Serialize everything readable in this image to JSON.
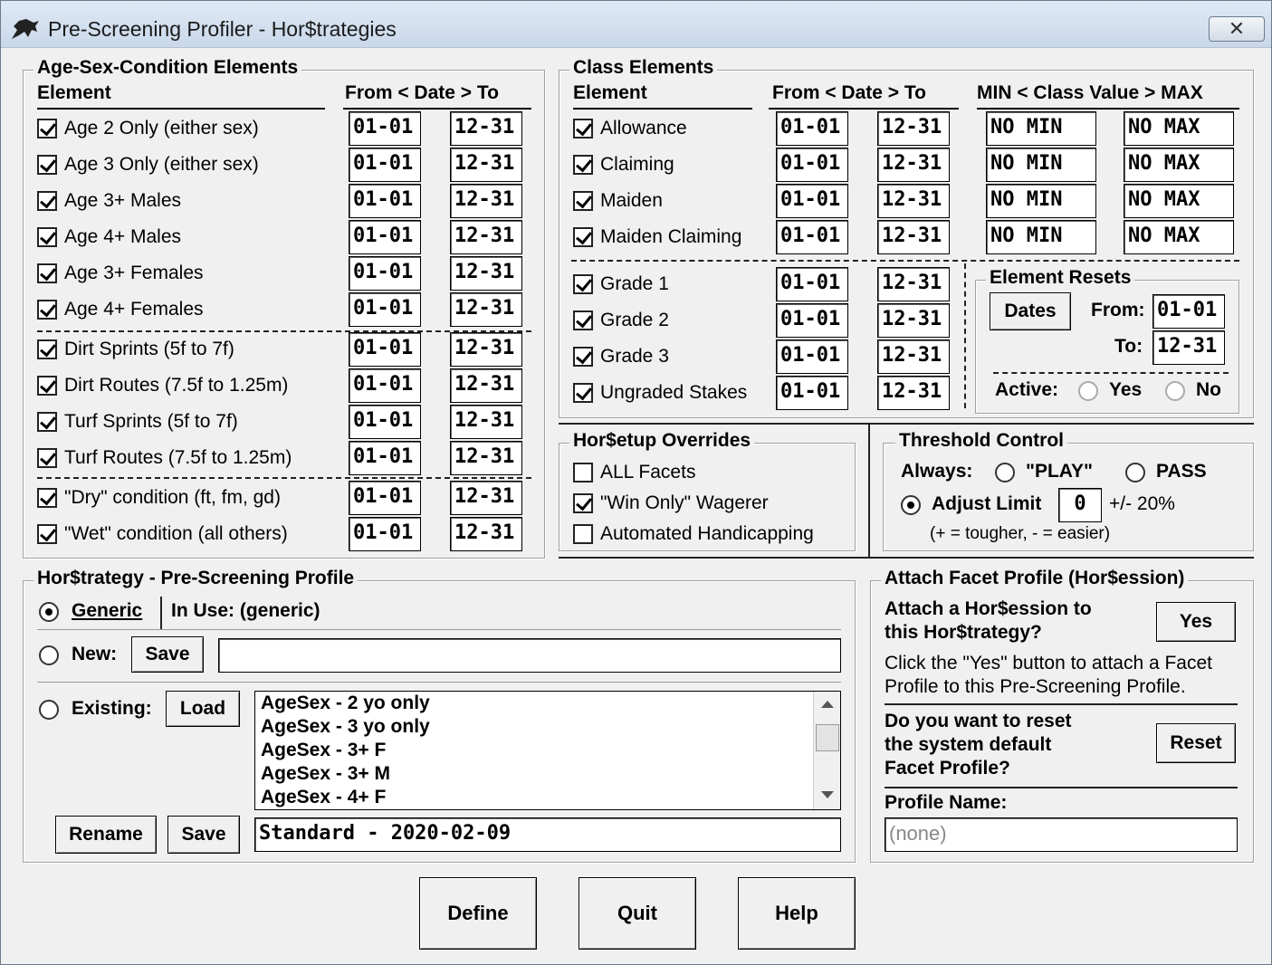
{
  "window": {
    "title": "Pre-Screening Profiler - Hor$trategies",
    "close_label": "✕"
  },
  "age_sex": {
    "legend": "Age-Sex-Condition Elements",
    "col_element": "Element",
    "col_date": "From < Date > To",
    "rows": [
      {
        "label": "Age 2 Only (either sex)",
        "checked": true,
        "from": "01-01",
        "to": "12-31"
      },
      {
        "label": "Age 3 Only (either sex)",
        "checked": true,
        "from": "01-01",
        "to": "12-31"
      },
      {
        "label": "Age 3+ Males",
        "checked": true,
        "from": "01-01",
        "to": "12-31"
      },
      {
        "label": "Age 4+ Males",
        "checked": true,
        "from": "01-01",
        "to": "12-31"
      },
      {
        "label": "Age 3+ Females",
        "checked": true,
        "from": "01-01",
        "to": "12-31"
      },
      {
        "label": "Age 4+ Females",
        "checked": true,
        "from": "01-01",
        "to": "12-31"
      },
      {
        "label": "Dirt Sprints (5f to 7f)",
        "checked": true,
        "from": "01-01",
        "to": "12-31"
      },
      {
        "label": "Dirt Routes (7.5f to 1.25m)",
        "checked": true,
        "from": "01-01",
        "to": "12-31"
      },
      {
        "label": "Turf Sprints (5f to 7f)",
        "checked": true,
        "from": "01-01",
        "to": "12-31"
      },
      {
        "label": "Turf Routes (7.5f to 1.25m)",
        "checked": true,
        "from": "01-01",
        "to": "12-31"
      },
      {
        "label": "\"Dry\" condition (ft, fm, gd)",
        "checked": true,
        "from": "01-01",
        "to": "12-31"
      },
      {
        "label": "\"Wet\" condition (all others)",
        "checked": true,
        "from": "01-01",
        "to": "12-31"
      }
    ]
  },
  "class": {
    "legend": "Class Elements",
    "col_element": "Element",
    "col_date": "From < Date > To",
    "col_value": "MIN < Class Value > MAX",
    "rows": [
      {
        "label": "Allowance",
        "checked": true,
        "from": "01-01",
        "to": "12-31",
        "min": "NO MIN",
        "max": "NO MAX"
      },
      {
        "label": "Claiming",
        "checked": true,
        "from": "01-01",
        "to": "12-31",
        "min": "NO MIN",
        "max": "NO MAX"
      },
      {
        "label": "Maiden",
        "checked": true,
        "from": "01-01",
        "to": "12-31",
        "min": "NO MIN",
        "max": "NO MAX"
      },
      {
        "label": "Maiden Claiming",
        "checked": true,
        "from": "01-01",
        "to": "12-31",
        "min": "NO MIN",
        "max": "NO MAX"
      },
      {
        "label": "Grade 1",
        "checked": true,
        "from": "01-01",
        "to": "12-31"
      },
      {
        "label": "Grade 2",
        "checked": true,
        "from": "01-01",
        "to": "12-31"
      },
      {
        "label": "Grade 3",
        "checked": true,
        "from": "01-01",
        "to": "12-31"
      },
      {
        "label": "Ungraded Stakes",
        "checked": true,
        "from": "01-01",
        "to": "12-31"
      }
    ]
  },
  "resets": {
    "legend": "Element Resets",
    "dates_label": "Dates",
    "from_label": "From:",
    "from_value": "01-01",
    "to_label": "To:",
    "to_value": "12-31",
    "active_label": "Active:",
    "yes_label": "Yes",
    "no_label": "No"
  },
  "overrides": {
    "legend": "Hor$etup Overrides",
    "items": [
      {
        "label": "ALL Facets",
        "checked": false
      },
      {
        "label": "\"Win Only\" Wagerer",
        "checked": true
      },
      {
        "label": "Automated Handicapping",
        "checked": false
      }
    ]
  },
  "threshold": {
    "legend": "Threshold Control",
    "always_label": "Always:",
    "play_label": "\"PLAY\"",
    "pass_label": "PASS",
    "adjust_label": "Adjust Limit",
    "adjust_value": "0",
    "pct_label": "+/- 20%",
    "hint": "(+ = tougher, - = easier)"
  },
  "profile": {
    "legend": "Hor$trategy - Pre-Screening Profile",
    "generic_label": "Generic",
    "in_use": "In Use: (generic)",
    "new_label": "New:",
    "save_label": "Save",
    "new_value": "",
    "existing_label": "Existing:",
    "load_label": "Load",
    "list_items": [
      "AgeSex - 2 yo only",
      "AgeSex - 3 yo only",
      "AgeSex - 3+ F",
      "AgeSex - 3+ M",
      "AgeSex - 4+ F"
    ],
    "rename_label": "Rename",
    "save2_label": "Save",
    "current_value": "Standard - 2020-02-09"
  },
  "facet": {
    "legend": "Attach Facet Profile (Hor$ession)",
    "question1_a": "Attach a Hor$ession to",
    "question1_b": "this Hor$trategy?",
    "yes_label": "Yes",
    "info_a": "Click the \"Yes\" button to attach a Facet",
    "info_b": "Profile to this Pre-Screening Profile.",
    "question2_a": "Do you want to reset",
    "question2_b": "the system default",
    "question2_c": "Facet Profile?",
    "reset_label": "Reset",
    "profile_name_label": "Profile Name:",
    "profile_name_value": "(none)"
  },
  "footer": {
    "define_label": "Define",
    "quit_label": "Quit",
    "help_label": "Help"
  }
}
